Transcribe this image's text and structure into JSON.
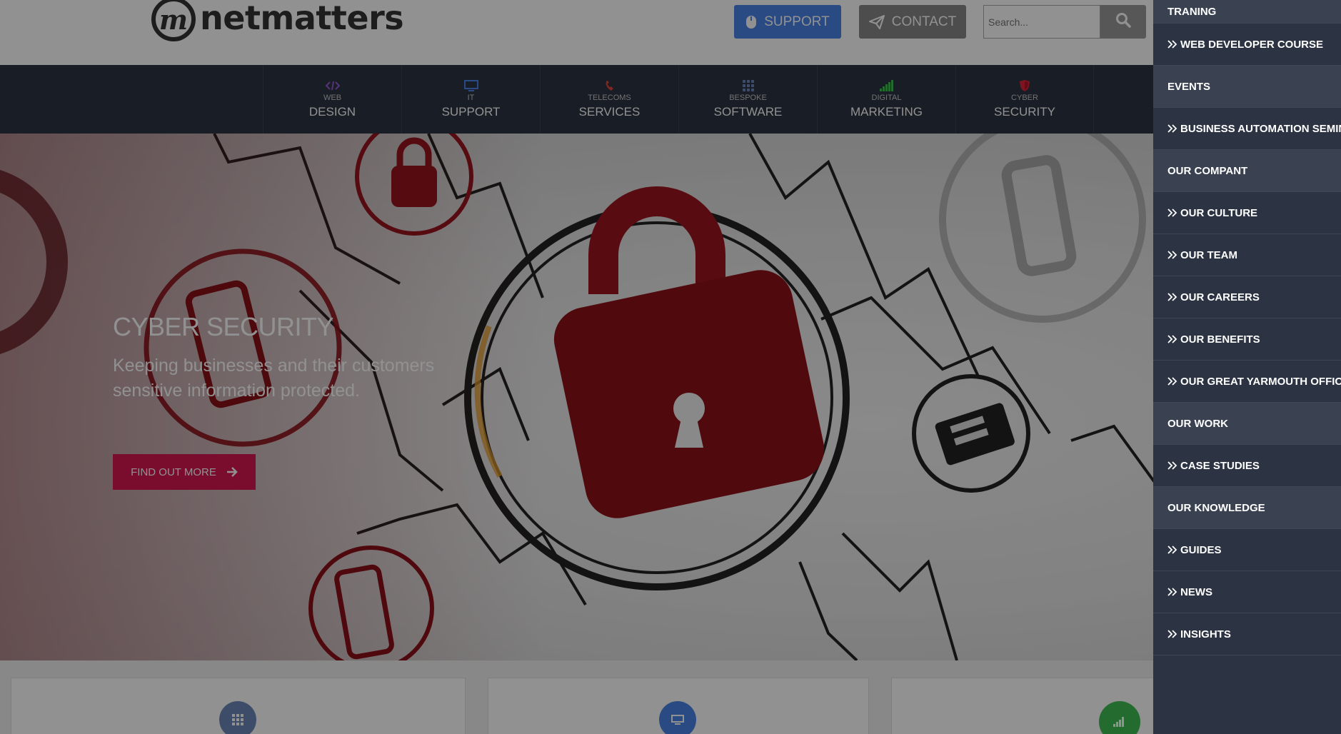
{
  "brand": {
    "name": "netmatters",
    "tm": "™",
    "mark": "m"
  },
  "header": {
    "support_label": "SUPPORT",
    "contact_label": "CONTACT",
    "search_placeholder": "Search..."
  },
  "nav": [
    {
      "small": "WEB",
      "big": "DESIGN",
      "icon": "code-icon",
      "color": "#9b59d0"
    },
    {
      "small": "IT",
      "big": "SUPPORT",
      "icon": "monitor-icon",
      "color": "#4a82e8"
    },
    {
      "small": "TELECOMS",
      "big": "SERVICES",
      "icon": "phone-icon",
      "color": "#e0443a"
    },
    {
      "small": "BESPOKE",
      "big": "SOFTWARE",
      "icon": "grid-icon",
      "color": "#6b87b8"
    },
    {
      "small": "DIGITAL",
      "big": "MARKETING",
      "icon": "signal-icon",
      "color": "#3ebd52"
    },
    {
      "small": "CYBER",
      "big": "SECURITY",
      "icon": "shield-icon",
      "color": "#e0243a"
    }
  ],
  "hero": {
    "title": "CYBER SECURITY",
    "subtitle": "Keeping businesses and their customers sensitive information protected.",
    "cta": "FIND OUT MORE"
  },
  "cards": [
    {
      "icon": "grid-icon",
      "color": "#6b87b8"
    },
    {
      "icon": "monitor-icon",
      "color": "#4a82e8"
    },
    {
      "icon": "signal-icon",
      "color": "#3ebd52"
    }
  ],
  "sidemenu": [
    {
      "label": "TRANING",
      "type": "heading"
    },
    {
      "label": "WEB DEVELOPER COURSE",
      "type": "link"
    },
    {
      "label": "EVENTS",
      "type": "heading"
    },
    {
      "label": "BUSINESS AUTOMATION SEMINAR",
      "type": "link"
    },
    {
      "label": "OUR COMPANT",
      "type": "heading"
    },
    {
      "label": "OUR CULTURE",
      "type": "link"
    },
    {
      "label": "OUR TEAM",
      "type": "link"
    },
    {
      "label": "OUR CAREERS",
      "type": "link"
    },
    {
      "label": "OUR BENEFITS",
      "type": "link"
    },
    {
      "label": "OUR GREAT YARMOUTH OFFICE",
      "type": "link"
    },
    {
      "label": "OUR WORK",
      "type": "heading"
    },
    {
      "label": "CASE STUDIES",
      "type": "link"
    },
    {
      "label": "OUR KNOWLEDGE",
      "type": "heading"
    },
    {
      "label": "GUIDES",
      "type": "link"
    },
    {
      "label": "NEWS",
      "type": "link"
    },
    {
      "label": "INSIGHTS",
      "type": "link"
    }
  ],
  "colors": {
    "nav_bg": "#2c3443",
    "support": "#4a82e8",
    "contact": "#888888",
    "cta": "#d6164f",
    "menu_heading_bg": "#3a4252"
  }
}
